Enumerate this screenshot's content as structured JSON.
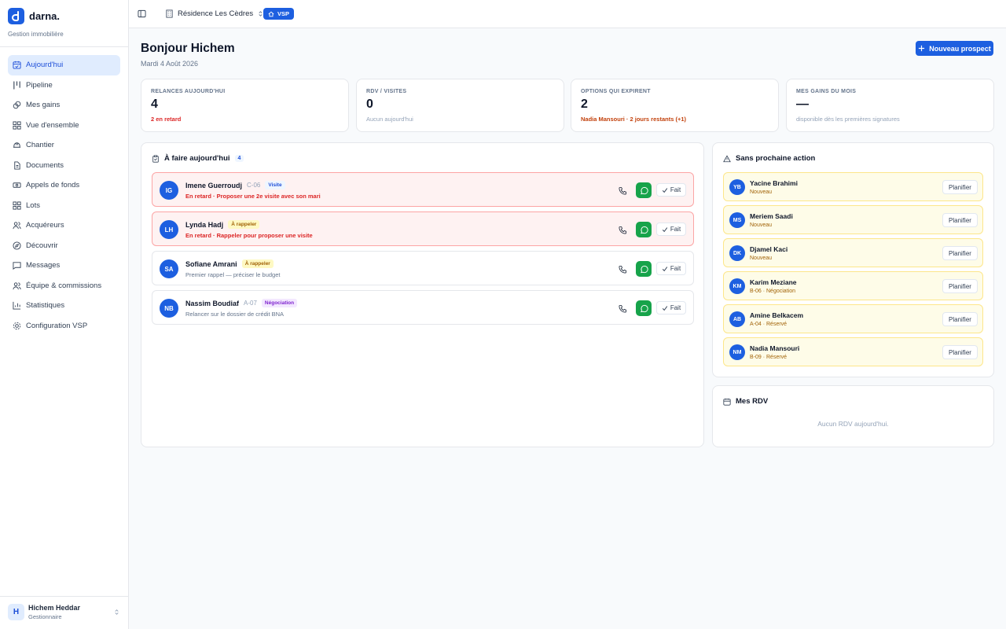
{
  "brand": {
    "name": "darna.",
    "subtitle": "Gestion immobilière"
  },
  "nav": [
    {
      "label": "Aujourd'hui",
      "icon": "calendar-check-icon",
      "active": true
    },
    {
      "label": "Pipeline",
      "icon": "pipeline-icon"
    },
    {
      "label": "Mes gains",
      "icon": "coins-icon"
    },
    {
      "label": "Vue d'ensemble",
      "icon": "grid-icon"
    },
    {
      "label": "Chantier",
      "icon": "helmet-icon"
    },
    {
      "label": "Documents",
      "icon": "document-icon"
    },
    {
      "label": "Appels de fonds",
      "icon": "banknote-icon"
    },
    {
      "label": "Lots",
      "icon": "grid-icon"
    },
    {
      "label": "Acquéreurs",
      "icon": "users-icon"
    },
    {
      "label": "Découvrir",
      "icon": "compass-icon"
    },
    {
      "label": "Messages",
      "icon": "message-icon"
    },
    {
      "label": "Équipe & commissions",
      "icon": "team-icon"
    },
    {
      "label": "Statistiques",
      "icon": "chart-icon"
    },
    {
      "label": "Configuration VSP",
      "icon": "gear-icon"
    }
  ],
  "user": {
    "initial": "H",
    "name": "Hichem Heddar",
    "role": "Gestionnaire"
  },
  "topbar": {
    "residence": "Résidence Les Cèdres",
    "vsp": "VSP"
  },
  "header": {
    "greeting": "Bonjour Hichem",
    "date": "Mardi 4 Août 2026",
    "new_prospect": "Nouveau prospect"
  },
  "stats": [
    {
      "label": "RELANCES AUJOURD'HUI",
      "value": "4",
      "sub": "2 en retard"
    },
    {
      "label": "RDV / VISITES",
      "value": "0",
      "sub": "Aucun aujourd'hui"
    },
    {
      "label": "OPTIONS QUI EXPIRENT",
      "value": "2",
      "sub": "Nadia Mansouri · 2 jours restants (+1)"
    },
    {
      "label": "MES GAINS DU MOIS",
      "value": "—",
      "sub": "disponible dès les premières signatures"
    }
  ],
  "todo": {
    "title": "À faire aujourd'hui",
    "count": "4",
    "done_label": "Fait",
    "items": [
      {
        "initials": "IG",
        "name": "Imene Guerroudj",
        "lot": "C-06",
        "badge": "Visite",
        "sub": "En retard · Proposer une 2e visite avec son mari"
      },
      {
        "initials": "LH",
        "name": "Lynda Hadj",
        "lot": "",
        "badge": "À rappeler",
        "sub": "En retard · Rappeler pour proposer une visite"
      },
      {
        "initials": "SA",
        "name": "Sofiane Amrani",
        "lot": "",
        "badge": "À rappeler",
        "sub": "Premier rappel — préciser le budget"
      },
      {
        "initials": "NB",
        "name": "Nassim Boudiaf",
        "lot": "A-07",
        "badge": "Négociation",
        "sub": "Relancer sur le dossier de crédit BNA"
      }
    ]
  },
  "no_action": {
    "title": "Sans prochaine action",
    "plan_label": "Planifier",
    "items": [
      {
        "initials": "YB",
        "name": "Yacine Brahimi",
        "sub": "Nouveau"
      },
      {
        "initials": "MS",
        "name": "Meriem Saadi",
        "sub": "Nouveau"
      },
      {
        "initials": "DK",
        "name": "Djamel Kaci",
        "sub": "Nouveau"
      },
      {
        "initials": "KM",
        "name": "Karim Meziane",
        "sub": "B-06 · Négociation"
      },
      {
        "initials": "AB",
        "name": "Amine Belkacem",
        "sub": "A-04 · Réservé"
      },
      {
        "initials": "NM",
        "name": "Nadia Mansouri",
        "sub": "B-09 · Réservé"
      }
    ]
  },
  "rdv": {
    "title": "Mes RDV",
    "empty": "Aucun RDV aujourd'hui."
  },
  "colors": {
    "accent": "#1d5fe0",
    "whatsapp": "#16a34a",
    "late_bg": "#fef2f2",
    "lead_bg": "#fefce8"
  }
}
